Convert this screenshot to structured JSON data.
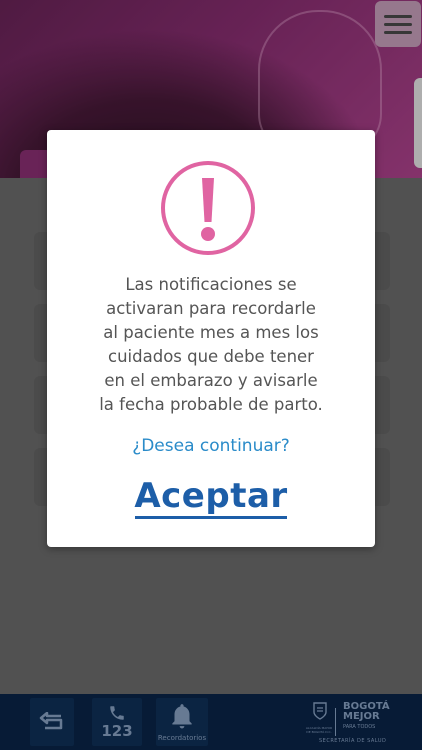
{
  "header": {
    "menu_icon": "hamburger-icon",
    "colors": {
      "primary": "#8a2e72",
      "accent": "#c9a0bd"
    }
  },
  "dialog": {
    "icon": "exclamation-circle-icon",
    "icon_color": "#e064a2",
    "message_lines": [
      "Las notificaciones se",
      "activaran para recordarle",
      "al paciente mes a mes los",
      "cuidados que debe tener",
      "en el embarazo y avisarle",
      "la fecha probable de parto."
    ],
    "question": "¿Desea continuar?",
    "accept_label": "Aceptar"
  },
  "bottom_nav": {
    "back_icon": "back-arrow-icon",
    "phone_icon": "phone-icon",
    "phone_number": "123",
    "reminders_icon": "bell-icon",
    "reminders_label": "Recordatorios",
    "logo": {
      "small_text": "ALCALDÍA MAYOR DE BOGOTÁ D.C.",
      "line1": "BOGOTÁ",
      "line2": "MEJOR",
      "line3": "PARA TODOS",
      "secretaria": "SECRETARÍA DE SALUD"
    }
  }
}
